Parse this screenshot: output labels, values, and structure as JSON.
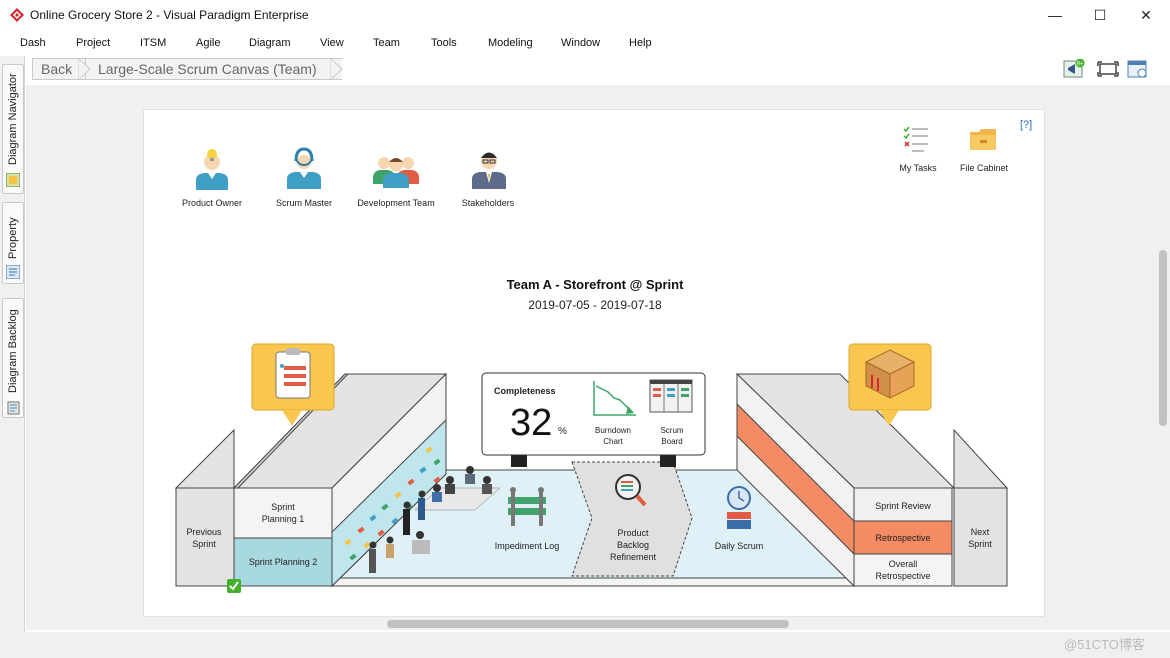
{
  "window": {
    "title": "Online Grocery Store 2 - Visual Paradigm Enterprise",
    "minimize": "—",
    "maximize": "☐",
    "close": "✕"
  },
  "menu": [
    "Dash",
    "Project",
    "ITSM",
    "Agile",
    "Diagram",
    "View",
    "Team",
    "Tools",
    "Modeling",
    "Window",
    "Help"
  ],
  "toolbar": {
    "back_label": "Back",
    "breadcrumb": "Large-Scale Scrum Canvas (Team)",
    "notification_badge": "9+"
  },
  "left_rail": {
    "tabs": [
      "Diagram Navigator",
      "Property",
      "Diagram Backlog"
    ]
  },
  "canvas": {
    "help_link": "[?]",
    "roles": [
      "Product Owner",
      "Scrum Master",
      "Development Team",
      "Stakeholders"
    ],
    "tools": [
      "My Tasks",
      "File Cabinet"
    ],
    "sprint_title": "Team A - Storefront @ Sprint",
    "sprint_dates": "2019-07-05 - 2019-07-18",
    "completeness": {
      "label": "Completeness",
      "value": "32",
      "unit": "%",
      "burndown_label_1": "Burndown",
      "burndown_label_2": "Chart",
      "scrum_board_label_1": "Scrum",
      "scrum_board_label_2": "Board"
    },
    "stages": {
      "previous_1": "Previous",
      "previous_2": "Sprint",
      "sprint_planning_1a": "Sprint",
      "sprint_planning_1b": "Planning 1",
      "sprint_planning_2": "Sprint Planning 2",
      "impediment_log": "Impediment Log",
      "pbr_1": "Product",
      "pbr_2": "Backlog",
      "pbr_3": "Refinement",
      "daily_scrum": "Daily Scrum",
      "sprint_review": "Sprint Review",
      "retrospective": "Retrospective",
      "overall_retro_1": "Overall",
      "overall_retro_2": "Retrospective",
      "next_1": "Next",
      "next_2": "Sprint"
    }
  },
  "watermark": "@51CTO博客",
  "colors": {
    "accent_cyan": "#b7e4ea",
    "accent_orange": "#f38b64",
    "callout_yellow": "#f9c74f",
    "completed_green": "#43b02a"
  }
}
